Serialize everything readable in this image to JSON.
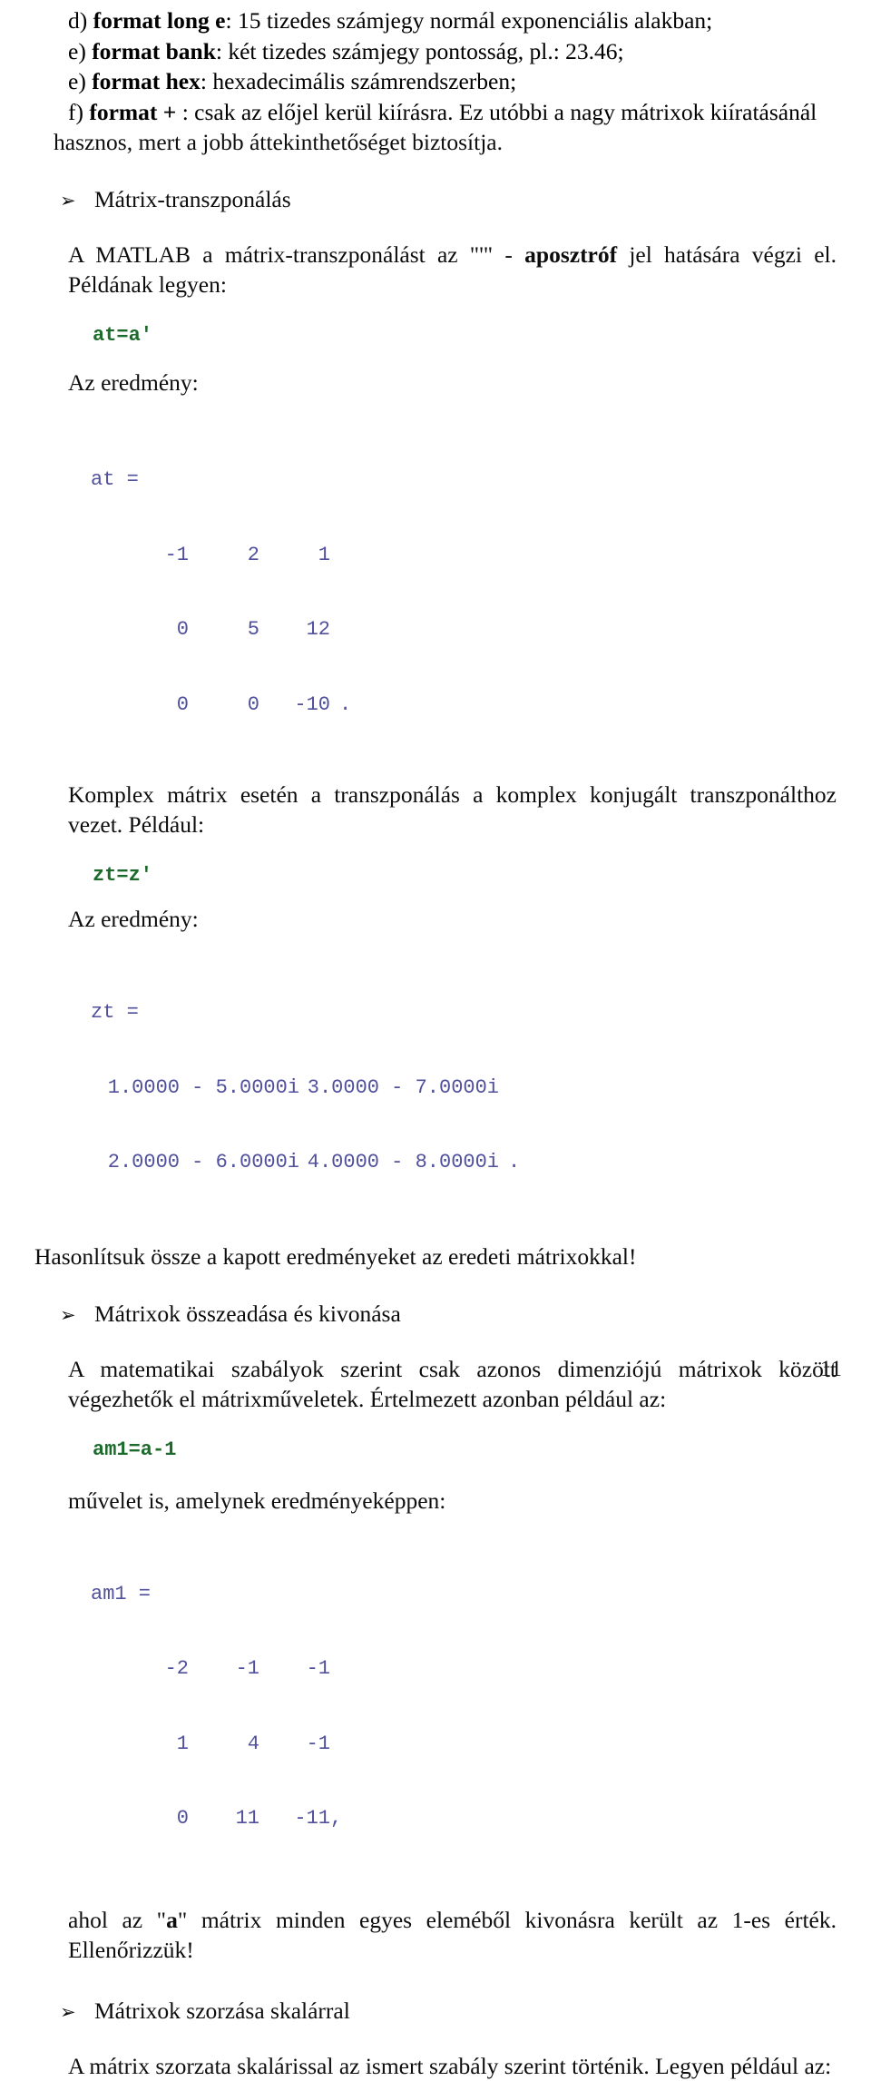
{
  "document": {
    "language": "hu",
    "page_number": "11",
    "colors": {
      "code_green": "#1c6b2c",
      "console_blue": "#50509c",
      "body_text": "#0d0d0d",
      "background": "#ffffff"
    }
  },
  "format_list": {
    "items": [
      {
        "marker": "d)",
        "keyword": "format long e",
        "rest": ": 15 tizedes számjegy normál exponenciális alakban;"
      },
      {
        "marker": "e)",
        "keyword": "format bank",
        "rest": ": két tizedes számjegy pontosság, pl.: 23.46;"
      },
      {
        "marker": "e)",
        "keyword": "format hex",
        "rest": ": hexadecimális számrendszerben;"
      },
      {
        "marker": "f)",
        "keyword": "format +",
        "rest": " : csak az előjel kerül kiírásra. Ez utóbbi a nagy mátrixok kiíratásánál"
      }
    ],
    "continuation": "hasznos, mert a jobb áttekinthetőséget biztosítja."
  },
  "sections": {
    "transpose": {
      "bullet_glyph": "➢",
      "heading": "Mátrix-transzponálás",
      "intro_pre": "A MATLAB a mátrix-transzponálást az \"'\" - ",
      "intro_bold": "aposztróf",
      "intro_post": " jel hatására végzi el. Példának legyen:",
      "code": "at=a'",
      "result_label": "Az eredmény:",
      "output_name": "at =",
      "matrix": [
        [
          "-1",
          "2",
          "1"
        ],
        [
          "0",
          "5",
          "12"
        ],
        [
          "0",
          "0",
          "-10"
        ]
      ],
      "matrix_trailer": "."
    },
    "complex": {
      "paragraph": "Komplex mátrix esetén a transzponálás a komplex konjugált transzponálthoz vezet. Például:",
      "code": "zt=z'",
      "result_label": "Az eredmény:",
      "output_name": "zt =",
      "matrix": [
        [
          "1.0000 - 5.0000i",
          "3.0000 - 7.0000i"
        ],
        [
          "2.0000 - 6.0000i",
          "4.0000 - 8.0000i"
        ]
      ],
      "matrix_trailer": ".",
      "closing": "Hasonlítsuk össze a kapott eredményeket az eredeti mátrixokkal!"
    },
    "addition": {
      "bullet_glyph": "➢",
      "heading": "Mátrixok összeadása és kivonása",
      "paragraph": "A matematikai szabályok szerint csak azonos dimenziójú mátrixok között végezhetők el mátrixműveletek. Értelmezett azonban például az:",
      "code": "am1=a-1",
      "mid_text": "művelet is, amelynek eredményeképpen:",
      "output_name": "am1 =",
      "matrix": [
        [
          "-2",
          "-1",
          "-1"
        ],
        [
          "1",
          "4",
          "-1"
        ],
        [
          "0",
          "11",
          "-11"
        ]
      ],
      "matrix_trailer": ",",
      "explanation_pre": "ahol az \"",
      "explanation_bold": "a",
      "explanation_post": "\" mátrix minden egyes eleméből kivonásra került az 1-es érték. Ellenőrizzük!"
    },
    "scalar_mult": {
      "bullet_glyph": "➢",
      "heading": "Mátrixok szorzása skalárral",
      "paragraph": "A mátrix szorzata skalárissal az ismert szabály szerint történik. Legyen például az:"
    }
  }
}
